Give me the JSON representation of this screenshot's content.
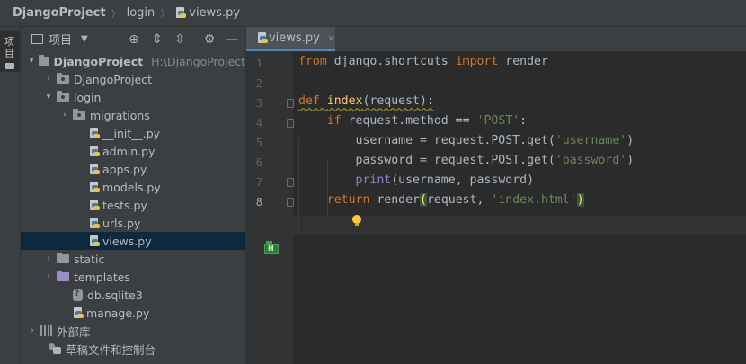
{
  "breadcrumb": {
    "project": "DjangoProject",
    "folder": "login",
    "file": "views.py"
  },
  "left_strip": {
    "label": "项目",
    "icon": "folder-icon"
  },
  "project_panel": {
    "title": "项目",
    "toolbar_icons": [
      "locate-icon",
      "expand-all-icon",
      "collapse-all-icon",
      "gear-icon",
      "minimize-icon"
    ],
    "tree": [
      {
        "label": "DjangoProject",
        "path": "H:\\DjangoProject",
        "arrow": "▾",
        "icon": "folder",
        "indent": 0,
        "bold": true
      },
      {
        "label": "DjangoProject",
        "arrow": "›",
        "icon": "folder-pkg",
        "indent": 1
      },
      {
        "label": "login",
        "arrow": "▾",
        "icon": "folder-pkg",
        "indent": 1
      },
      {
        "label": "migrations",
        "arrow": "›",
        "icon": "folder-pkg",
        "indent": 2
      },
      {
        "label": "__init__.py",
        "icon": "py",
        "indent": 3
      },
      {
        "label": "admin.py",
        "icon": "py",
        "indent": 3
      },
      {
        "label": "apps.py",
        "icon": "py",
        "indent": 3
      },
      {
        "label": "models.py",
        "icon": "py",
        "indent": 3
      },
      {
        "label": "tests.py",
        "icon": "py",
        "indent": 3
      },
      {
        "label": "urls.py",
        "icon": "py",
        "indent": 3
      },
      {
        "label": "views.py",
        "icon": "py",
        "indent": 3,
        "selected": true
      },
      {
        "label": "static",
        "arrow": "›",
        "icon": "folder",
        "indent": 1
      },
      {
        "label": "templates",
        "arrow": "›",
        "icon": "folder-tpl",
        "indent": 1
      },
      {
        "label": "db.sqlite3",
        "icon": "db",
        "indent": 2
      },
      {
        "label": "manage.py",
        "icon": "py",
        "indent": 2
      },
      {
        "label": "外部库",
        "arrow": "›",
        "icon": "lib",
        "indent": 0
      },
      {
        "label": "草稿文件和控制台",
        "icon": "console",
        "indent": 0.5
      }
    ]
  },
  "editor": {
    "tab_label": "views.py",
    "tab_close": "×",
    "line_numbers": [
      "1",
      "2",
      "3",
      "4",
      "5",
      "6",
      "7",
      "8"
    ],
    "lines": [
      [
        {
          "t": "from ",
          "c": "kw"
        },
        {
          "t": "django.shortcuts ",
          "c": ""
        },
        {
          "t": "import ",
          "c": "kw"
        },
        {
          "t": "render",
          "c": ""
        }
      ],
      [],
      [
        {
          "t": "def ",
          "c": "kw squiggle"
        },
        {
          "t": "index",
          "c": "fn squiggle"
        },
        {
          "t": "(request):",
          "c": "squiggle"
        }
      ],
      [
        {
          "t": "    if ",
          "c": "kw"
        },
        {
          "t": "request.method == ",
          "c": ""
        },
        {
          "t": "'POST'",
          "c": "str"
        },
        {
          "t": ":",
          "c": ""
        }
      ],
      [
        {
          "t": "        username = request.POST.get(",
          "c": ""
        },
        {
          "t": "'username'",
          "c": "str"
        },
        {
          "t": ")",
          "c": ""
        }
      ],
      [
        {
          "t": "        password = request.POST.get(",
          "c": ""
        },
        {
          "t": "'password'",
          "c": "str"
        },
        {
          "t": ")",
          "c": ""
        }
      ],
      [
        {
          "t": "        ",
          "c": ""
        },
        {
          "t": "print",
          "c": "builtin"
        },
        {
          "t": "(username, password)",
          "c": ""
        }
      ],
      [
        {
          "t": "    ",
          "c": ""
        },
        {
          "t": "return ",
          "c": "kw"
        },
        {
          "t": "render",
          "c": ""
        },
        {
          "t": "(",
          "c": "brace-match"
        },
        {
          "t": "request, ",
          "c": ""
        },
        {
          "t": "'index.html'",
          "c": "str"
        },
        {
          "t": ")",
          "c": "brace-match"
        }
      ]
    ]
  },
  "colors": {
    "keyword": "#cc7832",
    "function": "#ffc66d",
    "string": "#6a8759",
    "builtin": "#8888c6",
    "selection": "#0d293e"
  }
}
